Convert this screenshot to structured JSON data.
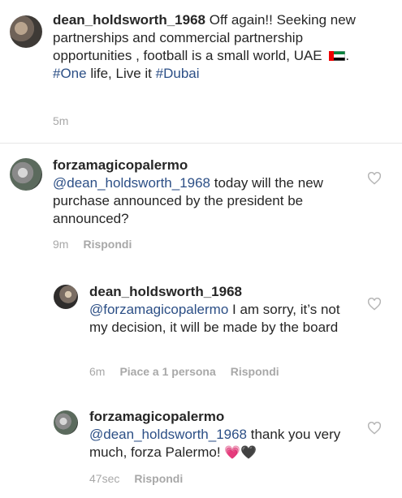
{
  "post": {
    "username": "dean_holdsworth_1968",
    "caption_before": " Off again!! Seeking new partnerships and commercial partnership opportunities , football is a small world, UAE ",
    "caption_after": ". ",
    "hashtag1": "#One",
    "caption_mid": " life, Live it ",
    "hashtag2": "#Dubai",
    "time": "5m"
  },
  "comments": [
    {
      "username": "forzamagicopalermo",
      "mention": "@dean_holdsworth_1968",
      "text": " today will the new purchase announced by the president be announced?",
      "time": "9m",
      "reply_label": "Rispondi"
    },
    {
      "username": "dean_holdsworth_1968",
      "mention": "@forzamagicopalermo",
      "text": " I am sorry, it’s not my decision, it will be made by the board",
      "time": "6m",
      "likes_label": "Piace a 1 persona",
      "reply_label": "Rispondi"
    },
    {
      "username": "forzamagicopalermo",
      "mention": "@dean_holdsworth_1968",
      "text": " thank you very much, forza Palermo! ",
      "emoji1": "💗",
      "emoji2": "🖤",
      "time": "47sec",
      "reply_label": "Rispondi"
    }
  ],
  "icons": {
    "like": "heart-outline-icon",
    "flag": "uae-flag-icon"
  },
  "colors": {
    "link": "#2c4f86",
    "meta": "#a8a8a8",
    "heart_outline": "#b5b5b5"
  }
}
